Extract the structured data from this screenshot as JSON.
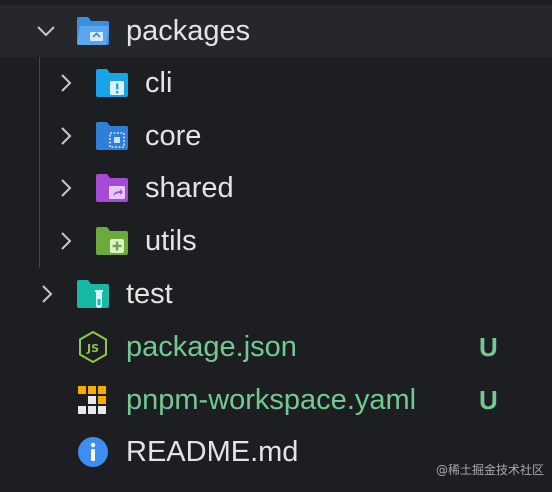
{
  "tree": {
    "packages": {
      "label": "packages",
      "icon": "folder-open-icon",
      "color": "#3b8fe0"
    },
    "cli": {
      "label": "cli",
      "icon": "folder-cli-icon",
      "color": "#1aa3e8"
    },
    "core": {
      "label": "core",
      "icon": "folder-core-icon",
      "color": "#2f7ed8"
    },
    "shared": {
      "label": "shared",
      "icon": "folder-shared-icon",
      "color": "#a64bd6"
    },
    "utils": {
      "label": "utils",
      "icon": "folder-utils-icon",
      "color": "#6aab3b"
    },
    "test": {
      "label": "test",
      "icon": "folder-test-icon",
      "color": "#17b8a6"
    },
    "package_json": {
      "label": "package.json",
      "status": "U",
      "icon": "nodejs-icon"
    },
    "pnpm_workspace": {
      "label": "pnpm-workspace.yaml",
      "status": "U",
      "icon": "pnpm-icon"
    },
    "readme": {
      "label": "README.md",
      "icon": "info-icon"
    }
  },
  "watermark": "@稀土掘金技术社区",
  "colors": {
    "background": "#1d1e22",
    "selected_row": "#26272b",
    "text": "#e4e4e4",
    "untracked": "#73c991"
  }
}
